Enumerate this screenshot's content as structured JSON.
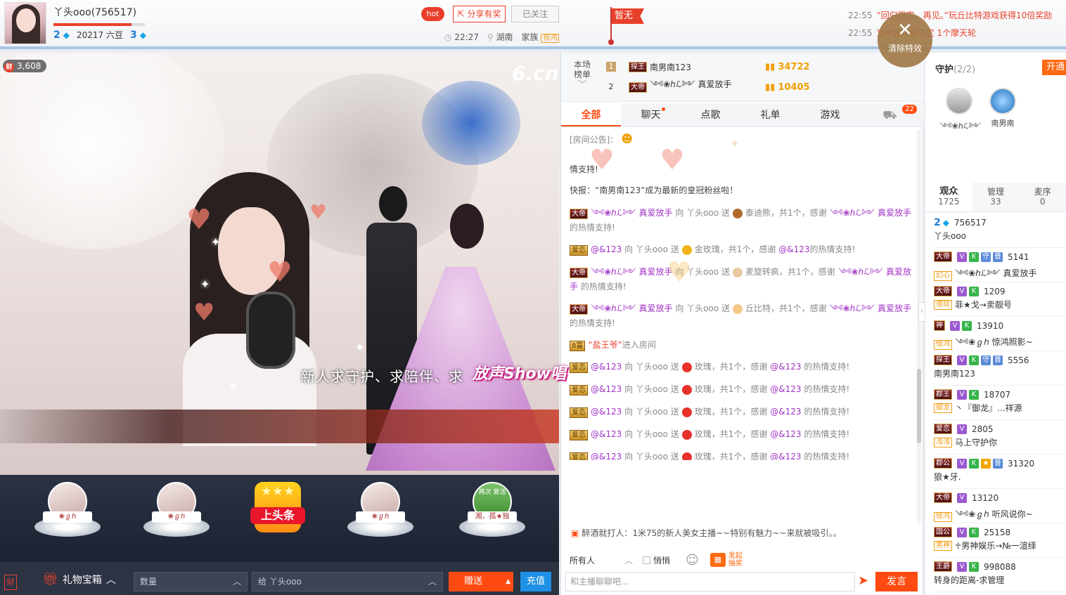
{
  "header": {
    "host_name": "丫头ooo(756517)",
    "host_level_left": "2",
    "host_beans": "20217 六豆",
    "host_level_right": "3",
    "hot_label": "hot",
    "share_label": "分享有奖",
    "follow_label": "已关注",
    "time": "22:27",
    "location": "湖南",
    "family_label": "家族",
    "family_badge": "惊鸿",
    "flag_label": "暂无",
    "ticker": [
      {
        "time": "22:55",
        "text": "“回归现实，再见。”玩丘比特游戏获得10倍奖励"
      },
      {
        "time": "22:55",
        "text": "宣❤做人要淡定  1个摩天轮"
      }
    ],
    "clear_fx_label": "清除特效",
    "host_progress": 0.85,
    "accent_color": "#e8412b"
  },
  "video": {
    "viewer_badge": "3,608",
    "cai_icon": "财",
    "site_logo": "6.cn",
    "banner_text": "新人求守护、求陪伴、求",
    "banner_logo": "放声Show唱"
  },
  "gift_row": {
    "items": [
      {
        "caption": "❀ℊℎ"
      },
      {
        "caption": "❀ℊℎ"
      },
      {
        "caption": "❀ℊℎ"
      },
      {
        "caption": "湘，孤★独",
        "top_text": "再次\n复活"
      }
    ],
    "headline_label": "上头条"
  },
  "bottom_bar": {
    "cai_label": "财",
    "giftbox_label": "礼物宝箱",
    "quantity_placeholder": "数量",
    "to_label": "给 丫头ooo",
    "send_label": "赠送",
    "recharge_label": "充值"
  },
  "rank": {
    "label": "本场\n榜单",
    "rows": [
      {
        "num": "1",
        "tag": "探王",
        "name": "南男南123",
        "score": "34722"
      },
      {
        "num": "2",
        "tag": "大帝",
        "name": "༺❀ℎℒ༻ 真爱放手",
        "score": "10405"
      }
    ]
  },
  "chat_tabs": [
    {
      "label": "全部"
    },
    {
      "label": "聊天"
    },
    {
      "label": "点歌"
    },
    {
      "label": "礼单"
    },
    {
      "label": "游戏"
    },
    {
      "label": "22"
    }
  ],
  "chat": {
    "announce": "[房间公告]：",
    "fragment": "情支持!",
    "flash": "快报：“南男南123”成为最新的皇冠粉丝啦！",
    "messages": [
      {
        "tag": "大帝",
        "user": "༺❀ℎℒ༻ 真爱放手",
        "mid": "向 丫头ooo 送",
        "gift": "泰迪熊，共1个，感谢",
        "thanks_user": "༺❀ℎℒ༻ 真爱放手",
        "tail": "的热情支持!"
      },
      {
        "tag": "爱恋",
        "user": "@&123",
        "mid": "向 丫头ooo 送",
        "gift": "金玫瑰，共1个，感谢",
        "thanks_user": "@&123",
        "tail": "的热情支持!"
      },
      {
        "tag": "大帝",
        "user": "༺❀ℎℒ༻ 真爱放手",
        "mid": "向 丫头ooo 送",
        "gift": "麦旋转疯，共1个，感谢",
        "thanks_user": "༺❀ℎℒ༻ 真爱放手",
        "tail": "的热情支持!"
      },
      {
        "tag": "大帝",
        "user": "༺❀ℎℒ༻ 真爱放手",
        "mid": "向 丫头ooo 送",
        "gift": "丘比特，共1个，感谢",
        "thanks_user": "༺❀ℎℒ༻ 真爱放手",
        "tail": "的热情支持!"
      }
    ],
    "enter": {
      "tag": "8富",
      "user": "“盐王爷”",
      "text": "进入房间"
    },
    "rose_messages": [
      {
        "tag": "爱恋",
        "user": "@&123",
        "mid": "向 丫头ooo 送",
        "gift": "玫瑰，共1个，感谢",
        "thanks_user": "@&123",
        "tail": "的热情支持!"
      },
      {
        "tag": "爱恋",
        "user": "@&123",
        "mid": "向 丫头ooo 送",
        "gift": "玫瑰，共1个，感谢",
        "thanks_user": "@&123",
        "tail": "的热情支持!"
      },
      {
        "tag": "爱恋",
        "user": "@&123",
        "mid": "向 丫头ooo 送",
        "gift": "玫瑰，共1个，感谢",
        "thanks_user": "@&123",
        "tail": "的热情支持!"
      },
      {
        "tag": "爱恋",
        "user": "@&123",
        "mid": "向 丫头ooo 送",
        "gift": "玫瑰，共1个，感谢",
        "thanks_user": "@&123",
        "tail": "的热情支持!"
      },
      {
        "tag": "爱恋",
        "user": "@&123",
        "mid": "向 丫头ooo 送",
        "gift": "玫瑰，共1个，感谢",
        "thanks_user": "@&123",
        "tail": "的热情支持!"
      }
    ],
    "notice": "醉酒就打人：1米75的新人美女主播~~特别有魅力~~来就被吸引。。",
    "recipient_select": "所有人",
    "whisper_label": "悄悄",
    "lottery_label": "发起\n抽奖",
    "input_placeholder": "和主播聊聊吧...",
    "send_label": "发言"
  },
  "guard": {
    "title": "守护",
    "count": "(2/2)",
    "open_label": "开通",
    "members": [
      {
        "name": "༺❀ℎℒ༻"
      },
      {
        "name": "南男南"
      }
    ]
  },
  "audience_tabs": [
    {
      "label": "观众",
      "count": "1725"
    },
    {
      "label": "管理",
      "count": "33"
    },
    {
      "label": "麦序",
      "count": "0"
    }
  ],
  "audience": [
    {
      "top": "2",
      "id": "756517",
      "name": "丫头ooo",
      "host": true
    },
    {
      "tag": "大帝",
      "badges": [
        "V",
        "K",
        "守",
        "普"
      ],
      "id": "5141",
      "fam": "幻心",
      "name": "༺❀ℎℒ༻ 真爱放手"
    },
    {
      "tag": "大帝",
      "badges": [
        "V",
        "K"
      ],
      "id": "1209",
      "fam": "德琰",
      "name": "菲★戈→卖靓号"
    },
    {
      "tag": "神",
      "badges": [
        "V",
        "K"
      ],
      "id": "13910",
      "fam": "惊鸿",
      "name": "༺❀ℊℎ 惊鸿照影~"
    },
    {
      "tag": "探王",
      "badges": [
        "V",
        "K",
        "守",
        "普"
      ],
      "id": "5556",
      "fam": "",
      "name": "南男南123"
    },
    {
      "tag": "郡王",
      "badges": [
        "V",
        "K"
      ],
      "id": "18707",
      "fam": "御龙",
      "name": "丶『御龙』...祥源"
    },
    {
      "tag": "爱恋",
      "badges": [
        "V"
      ],
      "id": "2805",
      "fam": "浅浅",
      "name": "马上守护你"
    },
    {
      "tag": "郡公",
      "badges": [
        "V",
        "K",
        "★",
        "普"
      ],
      "id": "31320",
      "fam": "",
      "name": "狼★牙."
    },
    {
      "tag": "大帝",
      "badges": [
        "V"
      ],
      "id": "13120",
      "fam": "惊鸿",
      "name": "༺❀ℊℎ 听风说你~"
    },
    {
      "tag": "国公",
      "badges": [
        "V",
        "K"
      ],
      "id": "25158",
      "fam": "男神",
      "name": "♱男神娱乐→№一渲绎"
    },
    {
      "tag": "王爵",
      "badges": [
        "V",
        "K"
      ],
      "id": "998088",
      "fam": "",
      "name": "转身的距离-求管理"
    }
  ]
}
